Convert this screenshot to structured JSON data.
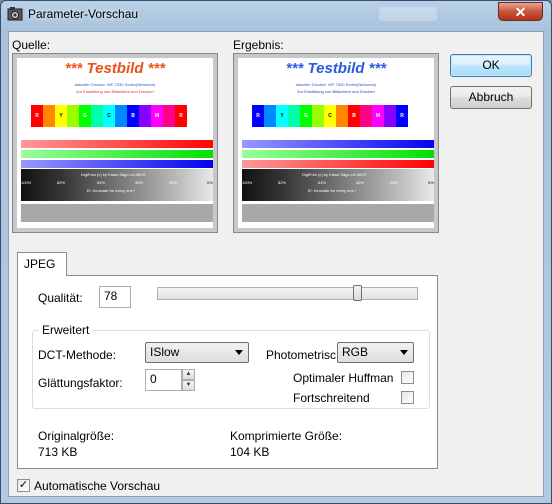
{
  "window": {
    "title": "Parameter-Vorschau",
    "close_glyph": "✕"
  },
  "preview": {
    "source_label": "Quelle:",
    "result_label": "Ergebnis:",
    "testbild_title": "*** Testbild ***",
    "testbild_line1": "aktueller Drucker: WF-7530 Series(Netzwerk)",
    "testbild_line2": "Zur Einstellung von Bildschirm und Drucker!",
    "swatch_letters": [
      "R",
      "",
      "Y",
      "",
      "G",
      "",
      "C",
      "",
      "B",
      "",
      "M",
      "",
      "R"
    ],
    "bw_texts": [
      "100%",
      "82%",
      "64%",
      "46%",
      "28%",
      "0%"
    ],
    "bw_caption1": "DigiFoto (c) by Klaus Sägo v.5.98.57",
    "bw_caption2": "E/: Innocate fur every one !"
  },
  "buttons": {
    "ok": "OK",
    "cancel": "Abbruch"
  },
  "tab": {
    "label": "JPEG"
  },
  "jpeg": {
    "quality_label": "Qualität:",
    "quality_value": "78",
    "quality_level": 78,
    "extended_title": "Erweitert",
    "dct_label": "DCT-Methode:",
    "dct_value": "ISlow",
    "photometric_label": "Photometrisc",
    "photometric_value": "RGB",
    "smoothing_label": "Glättungsfaktor:",
    "smoothing_value": "0",
    "optimal_huffman_label": "Optimaler Huffman",
    "optimal_huffman_checked": false,
    "progressive_label": "Fortschreitend",
    "progressive_checked": false,
    "original_size_label": "Originalgröße:",
    "original_size_value": "713 KB",
    "compressed_size_label": "Komprimierte Größe:",
    "compressed_size_value": "104 KB"
  },
  "auto_preview": {
    "label": "Automatische Vorschau",
    "checked": true,
    "check_glyph": "✓"
  },
  "colors": {
    "source_title": "#e8541a",
    "result_title": "#2a5be0",
    "accent": "#3c7fb1"
  }
}
